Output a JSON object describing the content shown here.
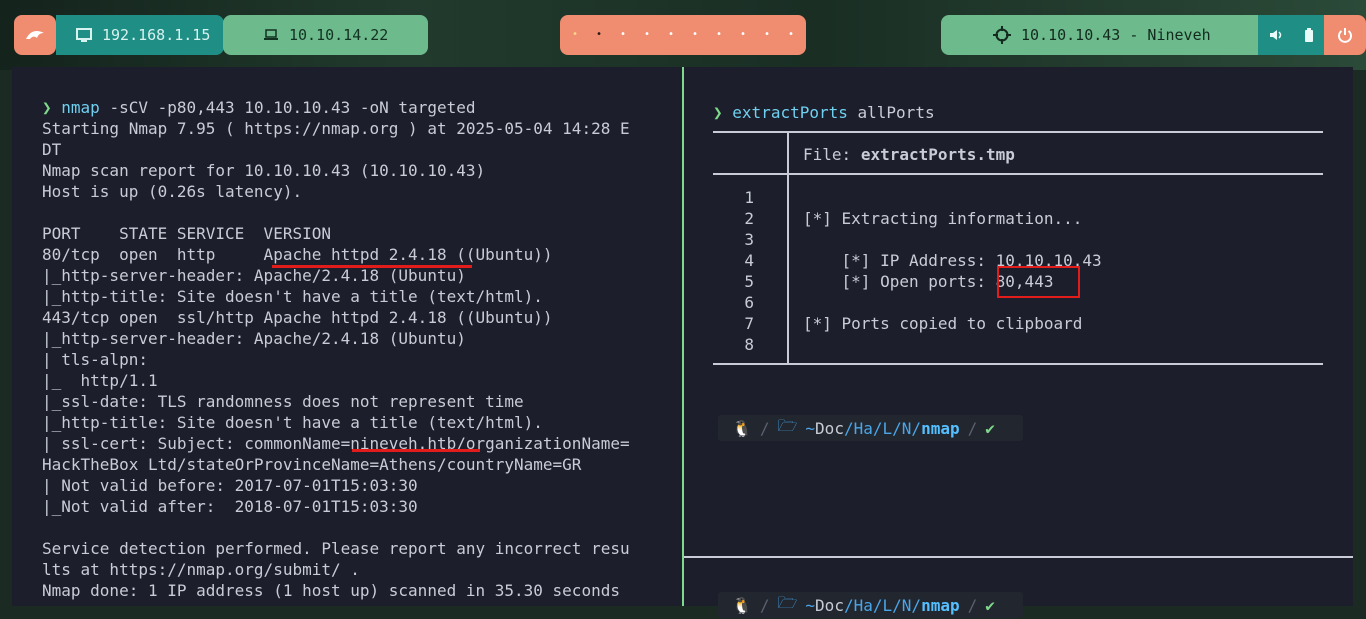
{
  "topbar": {
    "local_ip": "192.168.1.15",
    "vpn_ip": "10.10.14.22",
    "target": "10.10.10.43 - Nineveh",
    "workspace_dots": [
      "•",
      "•",
      "•",
      "•",
      "•",
      "•",
      "•",
      "•",
      "•",
      "•"
    ]
  },
  "left_term": {
    "prompt": "❯",
    "cmd": "nmap",
    "args": " -sCV -p80,443 10.10.10.43 -oN targeted",
    "lines": [
      "Starting Nmap 7.95 ( https://nmap.org ) at 2025-05-04 14:28 E",
      "DT",
      "Nmap scan report for 10.10.10.43 (10.10.10.43)",
      "Host is up (0.26s latency).",
      "",
      "PORT    STATE SERVICE  VERSION",
      "80/tcp  open  http     Apache httpd 2.4.18 ((Ubuntu))",
      "|_http-server-header: Apache/2.4.18 (Ubuntu)",
      "|_http-title: Site doesn't have a title (text/html).",
      "443/tcp open  ssl/http Apache httpd 2.4.18 ((Ubuntu))",
      "|_http-server-header: Apache/2.4.18 (Ubuntu)",
      "| tls-alpn:",
      "|_  http/1.1",
      "|_ssl-date: TLS randomness does not represent time",
      "|_http-title: Site doesn't have a title (text/html).",
      "| ssl-cert: Subject: commonName=nineveh.htb/organizationName=",
      "HackTheBox Ltd/stateOrProvinceName=Athens/countryName=GR",
      "| Not valid before: 2017-07-01T15:03:30",
      "|_Not valid after:  2018-07-01T15:03:30",
      "",
      "Service detection performed. Please report any incorrect resu",
      "lts at https://nmap.org/submit/ .",
      "Nmap done: 1 IP address (1 host up) scanned in 35.30 seconds"
    ]
  },
  "right_term": {
    "prompt": "❯",
    "cmd": "extractPorts",
    "arg": "allPorts",
    "file_label": "File:",
    "file_name": "extractPorts.tmp",
    "line_numbers": [
      "1",
      "2",
      "3",
      "4",
      "5",
      "6",
      "7",
      "8"
    ],
    "content": [
      "",
      "[*] Extracting information...",
      "",
      "    [*] IP Address: 10.10.10.43",
      "    [*] Open ports: ",
      "",
      "[*] Ports copied to clipboard",
      ""
    ],
    "open_ports_value": "80,443",
    "ps_path_root": "~",
    "ps_path_parts": [
      "Doc",
      "Ha",
      "L",
      "N"
    ],
    "ps_dir": "nmap",
    "ps_ok": "✔"
  },
  "colors": {
    "accent_orange": "#f08c6f",
    "accent_teal": "#1f8f86",
    "accent_green": "#6dba8c",
    "highlight_red": "#e21b1b"
  }
}
